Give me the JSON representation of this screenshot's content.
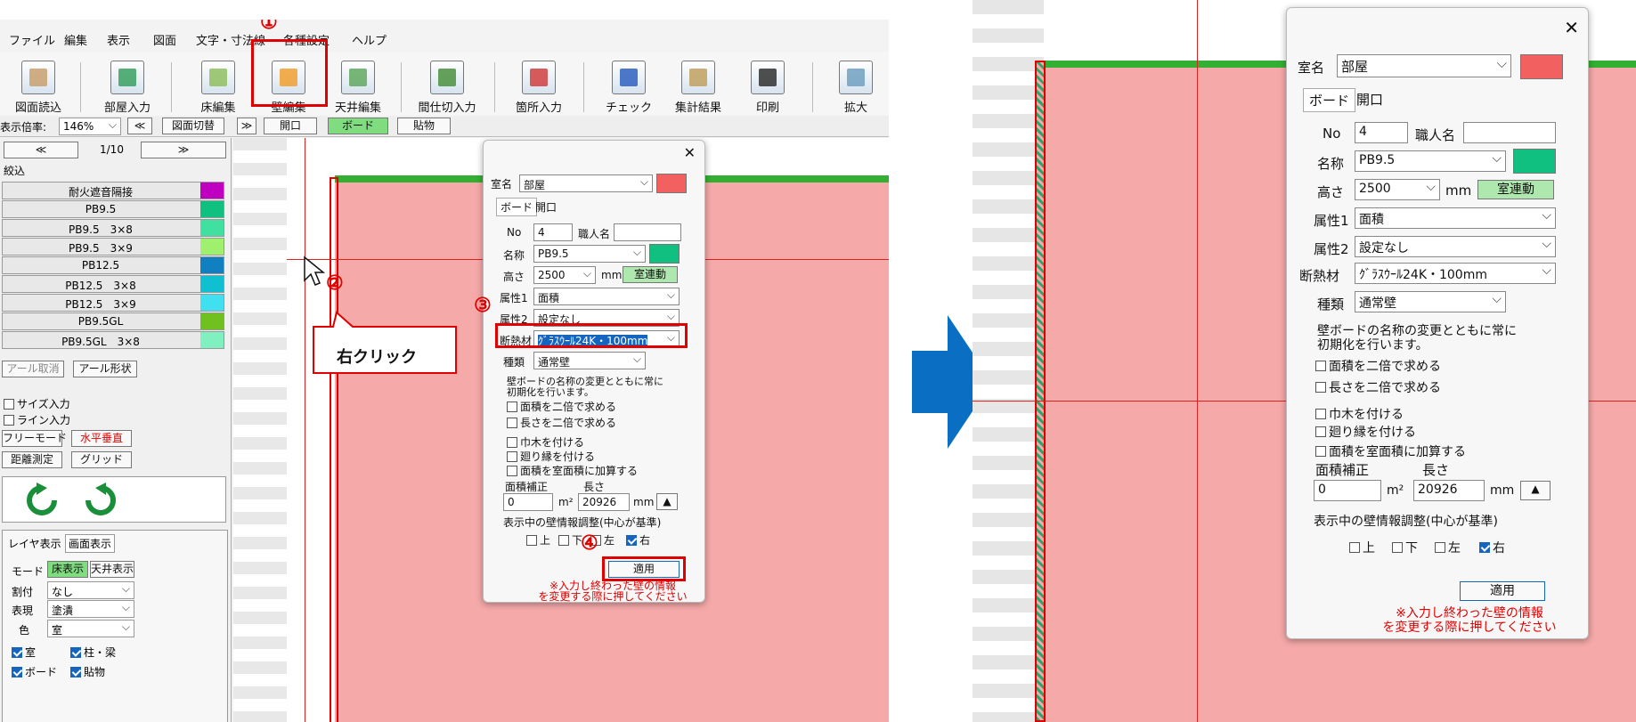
{
  "left": {
    "menu": [
      "ファイル",
      "編集",
      "表示",
      "図面",
      "文字・寸法線",
      "各種設定",
      "ヘルプ"
    ],
    "tools": [
      {
        "label": "図面読込",
        "icon": "drawing-load-icon",
        "color": "#c8a070"
      },
      {
        "label": "部屋入力",
        "icon": "room-input-icon",
        "color": "#3aa060"
      },
      {
        "label": "床編集",
        "icon": "floor-edit-icon",
        "color": "#8fbf5f"
      },
      {
        "label": "壁編集",
        "icon": "wall-edit-icon",
        "color": "#f0a030"
      },
      {
        "label": "天井編集",
        "icon": "ceiling-edit-icon",
        "color": "#60a860"
      },
      {
        "label": "間仕切入力",
        "icon": "partition-icon",
        "color": "#4a9040"
      },
      {
        "label": "箇所入力",
        "icon": "location-input-icon",
        "color": "#d04040"
      },
      {
        "label": "チェック",
        "icon": "check-icon",
        "color": "#3060c0"
      },
      {
        "label": "集計結果",
        "icon": "summary-icon",
        "color": "#c0a060"
      },
      {
        "label": "印刷",
        "icon": "print-icon",
        "color": "#303030"
      },
      {
        "label": "拡大",
        "icon": "zoom-icon",
        "color": "#70a0c0"
      }
    ],
    "zoom_label": "表示倍率:",
    "zoom_value": "146%",
    "prev_btn": "≪",
    "switch_btn": "図面切替",
    "next_btn": "≫",
    "tab_opening": "開口",
    "tab_board": "ボード",
    "tab_sticker": "貼物",
    "page_prev": "≪",
    "page_num": "1/10",
    "page_next": "≫",
    "filter_label": "絞込",
    "materials": [
      {
        "name": "耐火遮音隔接",
        "color": "#c000c0"
      },
      {
        "name": "PB9.5",
        "color": "#10c080"
      },
      {
        "name": "PB9.5　3×8",
        "color": "#40e0a0"
      },
      {
        "name": "PB9.5　3×9",
        "color": "#a0f070"
      },
      {
        "name": "PB12.5",
        "color": "#1080c0"
      },
      {
        "name": "PB12.5　3×8",
        "color": "#10c0d0"
      },
      {
        "name": "PB12.5　3×9",
        "color": "#40e0f0"
      },
      {
        "name": "PB9.5GL",
        "color": "#70c020"
      },
      {
        "name": "PB9.5GL　3×8",
        "color": "#80f0c0"
      }
    ],
    "arc_cancel": "アール取消",
    "arc_shape": "アール形状",
    "size_input": "サイズ入力",
    "line_input": "ライン入力",
    "free_mode": "フリーモード",
    "hv_mode": "水平垂直",
    "distance": "距離測定",
    "grid": "グリッド",
    "layer_tab": "レイヤ表示",
    "screen_tab": "画面表示",
    "mode_label": "モード",
    "floor_view": "床表示",
    "ceiling_view": "天井表示",
    "alloc_label": "割付",
    "alloc_value": "なし",
    "expr_label": "表現",
    "expr_value": "塗潰",
    "color_label": "色",
    "color_value": "室",
    "chk_room": "室",
    "chk_pillar": "柱・梁",
    "chk_board": "ボード",
    "chk_sticker": "貼物",
    "right_click": "右クリック",
    "nums": [
      "①",
      "②",
      "③",
      "④"
    ]
  },
  "dialog": {
    "room_label": "室名",
    "room_value": "部屋",
    "room_color": "#f26060",
    "tab_board": "ボード",
    "tab_opening": "開口",
    "no_label": "No",
    "no_value": "4",
    "worker_label": "職人名",
    "worker_value": "",
    "name_label": "名称",
    "name_value": "PB9.5",
    "name_color": "#10c080",
    "height_label": "高さ",
    "height_value": "2500",
    "height_unit": "mm",
    "room_link": "室連動",
    "attr1_label": "属性1",
    "attr1_value": "面積",
    "attr2_label": "属性2",
    "attr2_value": "設定なし",
    "insul_label": "断熱材",
    "insul_value": "ｸﾞﾗｽｳｰﾙ24K・100mm",
    "kind_label": "種類",
    "kind_value": "通常壁",
    "init_note1": "壁ボードの名称の変更とともに常に",
    "init_note2": "初期化を行います。",
    "double_area": "面積を二倍で求める",
    "double_len": "長さを二倍で求める",
    "baseboard": "巾木を付ける",
    "mawari": "廻り縁を付ける",
    "add_area": "面積を室面積に加算する",
    "area_adj_label": "面積補正",
    "length_label": "長さ",
    "area_adj_value": "0",
    "area_unit": "m²",
    "length_value": "20926",
    "length_unit": "mm",
    "adjust_label": "表示中の壁情報調整(中心が基準)",
    "dir_up": "上",
    "dir_down": "下",
    "dir_left": "左",
    "dir_right": "右",
    "apply": "適用",
    "note1": "※入力し終わった壁の情報",
    "note2": "を変更する際に押してください"
  },
  "colors": {
    "accent_red": "#e00000",
    "arrow_blue": "#0a6fc2",
    "pink": "#f6a9a9",
    "green_line": "#33b033"
  }
}
